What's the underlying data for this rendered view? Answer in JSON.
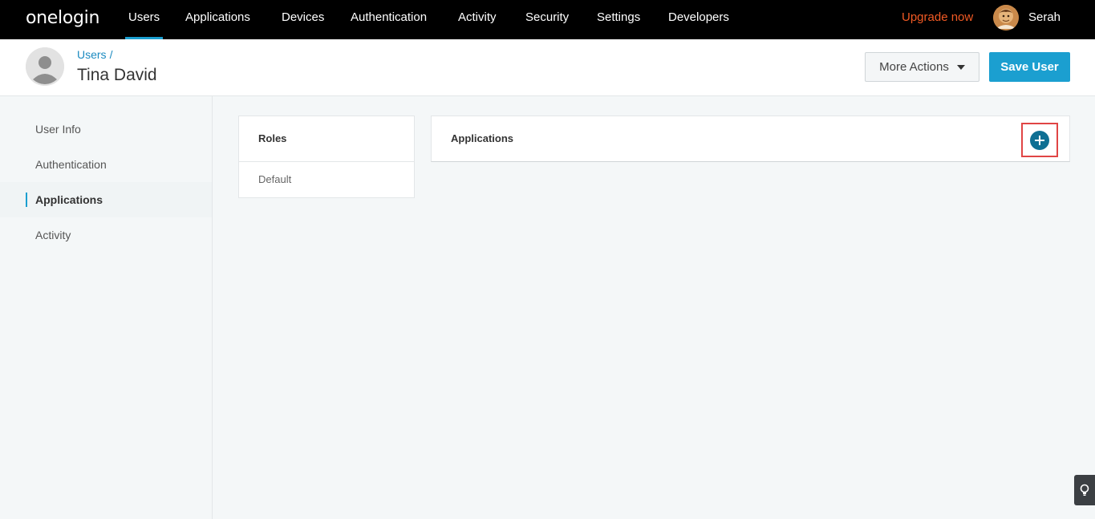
{
  "brand": {
    "logo_text": "onelogin"
  },
  "nav": {
    "items": [
      {
        "label": "Users",
        "active": true
      },
      {
        "label": "Applications"
      },
      {
        "label": "Devices"
      },
      {
        "label": "Authentication"
      },
      {
        "label": "Activity"
      },
      {
        "label": "Security"
      },
      {
        "label": "Settings"
      },
      {
        "label": "Developers"
      }
    ],
    "upgrade_label": "Upgrade now",
    "user_name": "Serah"
  },
  "header": {
    "breadcrumb_parent": "Users",
    "breadcrumb_separator": "/",
    "title": "Tina David",
    "more_actions_label": "More Actions",
    "save_label": "Save User"
  },
  "sidebar": {
    "items": [
      {
        "label": "User Info"
      },
      {
        "label": "Authentication"
      },
      {
        "label": "Applications",
        "active": true
      },
      {
        "label": "Activity"
      }
    ]
  },
  "roles": {
    "heading": "Roles",
    "items": [
      "Default"
    ]
  },
  "applications": {
    "heading": "Applications"
  },
  "colors": {
    "accent": "#1b9fd0",
    "upgrade": "#f15a24",
    "add_button": "#0f6f93",
    "highlight_box": "#e04545"
  }
}
